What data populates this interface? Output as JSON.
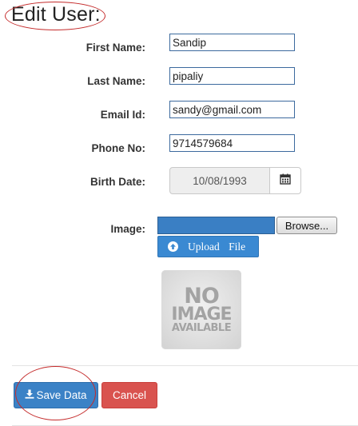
{
  "page": {
    "title": "Edit User:"
  },
  "form": {
    "first_name": {
      "label": "First Name:",
      "value": "Sandip"
    },
    "last_name": {
      "label": "Last Name:",
      "value": "pipaliy"
    },
    "email": {
      "label": "Email Id:",
      "value": "sandy@gmail.com"
    },
    "phone": {
      "label": "Phone No:",
      "value": "9714579684"
    },
    "birth_date": {
      "label": "Birth Date:",
      "value": "10/08/1993",
      "icon": "calendar-icon"
    },
    "image": {
      "label": "Image:",
      "browse_label": "Browse...",
      "upload_label": "Upload File",
      "upload_icon": "circle-arrow-up-icon",
      "placeholder_lines": [
        "NO",
        "IMAGE",
        "AVAILABLE"
      ]
    }
  },
  "actions": {
    "save_label": "Save Data",
    "save_icon": "download-icon",
    "cancel_label": "Cancel"
  },
  "colors": {
    "primary": "#3b82c6",
    "danger": "#d9534f",
    "annotation": "#c42a2a",
    "input_border": "#3c6a9e"
  }
}
